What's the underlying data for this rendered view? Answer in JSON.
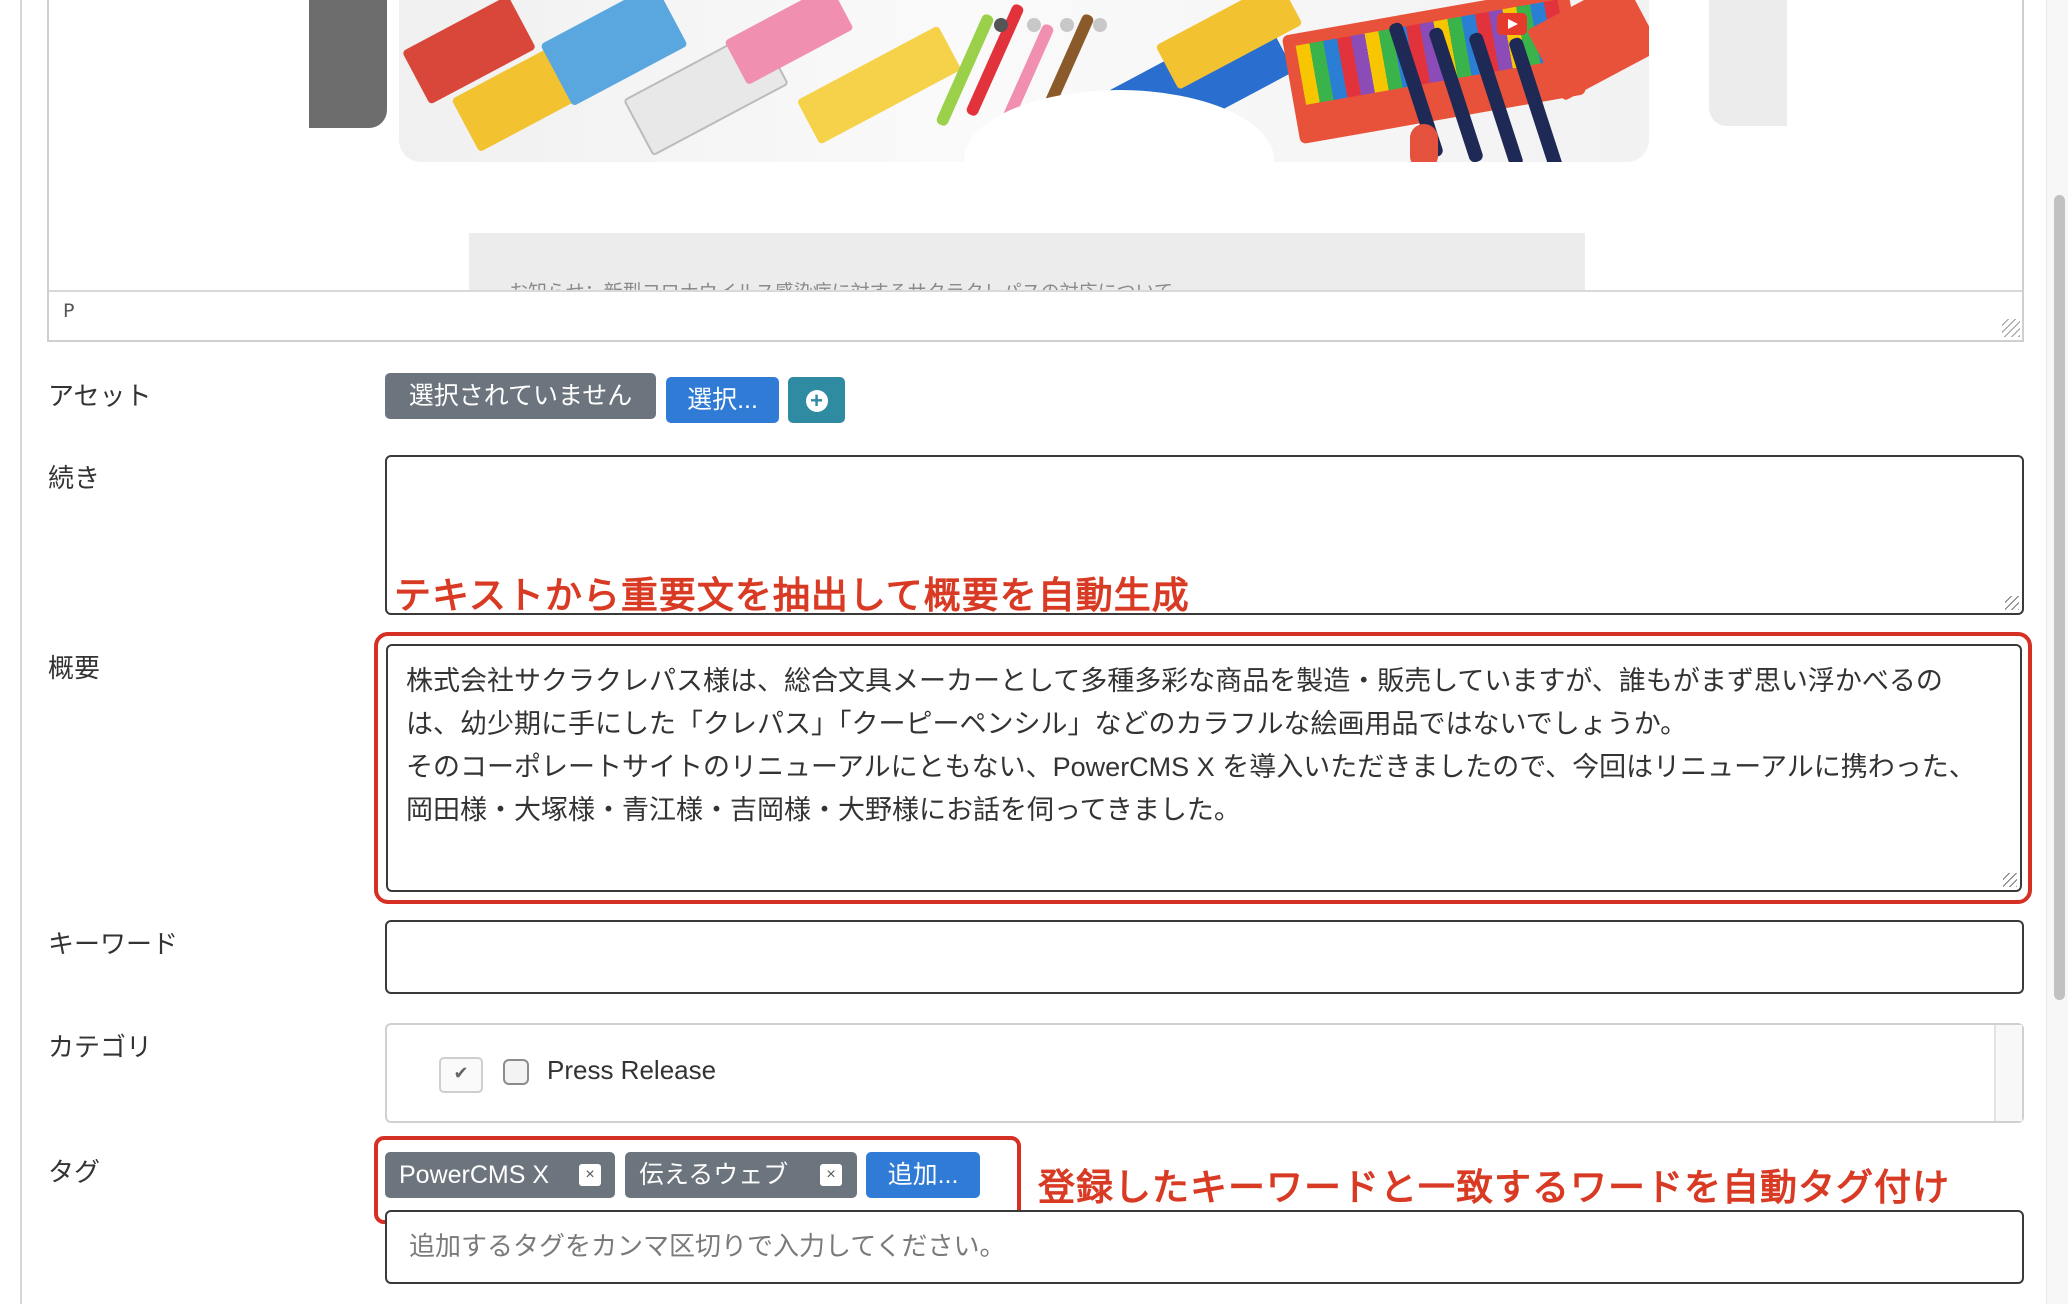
{
  "editor": {
    "path_indicator": "P",
    "news_text": "お知らせ：新型コロナウイルス感染症に対するサクラクレパスの対応について"
  },
  "asset": {
    "label": "アセット",
    "none_selected": "選択されていません",
    "select_button": "選択...",
    "add_icon": "plus-circle-icon"
  },
  "more": {
    "label": "続き",
    "value": ""
  },
  "summary": {
    "label": "概要",
    "value": "株式会社サクラクレパス様は、総合文具メーカーとして多種多彩な商品を製造・販売していますが、誰もがまず思い浮かべるのは、幼少期に手にした「クレパス」「クーピーペンシル」などのカラフルな絵画用品ではないでしょうか。\nそのコーポレートサイトのリニューアルにともない、PowerCMS X を導入いただきましたので、今回はリニューアルに携わった、岡田様・大塚様・青江様・吉岡様・大野様にお話を伺ってきました。",
    "annotation": "テキストから重要文を抽出して概要を自動生成"
  },
  "keywords": {
    "label": "キーワード",
    "value": ""
  },
  "category": {
    "label": "カテゴリ",
    "items": [
      {
        "label": "Press Release",
        "checked": false
      }
    ]
  },
  "tags": {
    "label": "タグ",
    "items": [
      "PowerCMS X",
      "伝えるウェブ"
    ],
    "remove_glyph": "×",
    "add_button": "追加...",
    "input_placeholder": "追加するタグをカンマ区切りで入力してください。",
    "annotation": "登録したキーワードと一致するワードを自動タグ付け"
  },
  "colors": {
    "annotation_red": "#d62f24",
    "primary_blue": "#2f7bd6",
    "secondary_gray": "#6c757d",
    "info_teal": "#2e8ba1"
  }
}
